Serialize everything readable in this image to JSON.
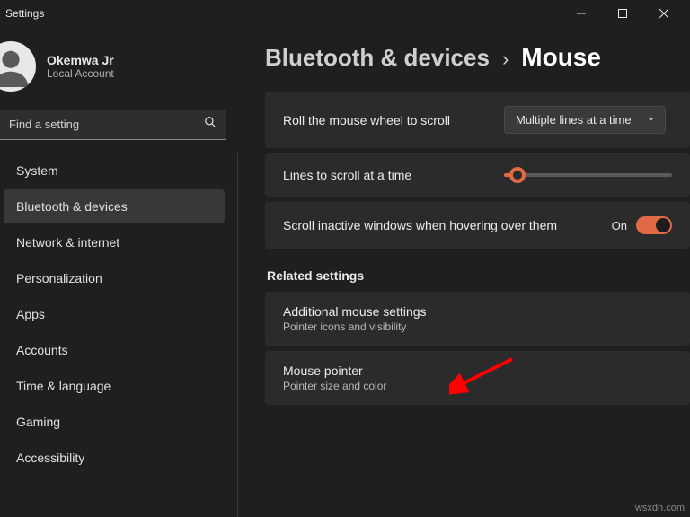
{
  "titlebar": {
    "title": "Settings"
  },
  "profile": {
    "name": "Okemwa Jr",
    "sub": "Local Account"
  },
  "search": {
    "placeholder": "Find a setting"
  },
  "nav": {
    "items": [
      {
        "label": "System"
      },
      {
        "label": "Bluetooth & devices"
      },
      {
        "label": "Network & internet"
      },
      {
        "label": "Personalization"
      },
      {
        "label": "Apps"
      },
      {
        "label": "Accounts"
      },
      {
        "label": "Time & language"
      },
      {
        "label": "Gaming"
      },
      {
        "label": "Accessibility"
      }
    ],
    "active_index": 1
  },
  "breadcrumb": {
    "parent": "Bluetooth & devices",
    "current": "Mouse"
  },
  "settings": {
    "roll_wheel": {
      "label": "Roll the mouse wheel to scroll",
      "value": "Multiple lines at a time"
    },
    "lines": {
      "label": "Lines to scroll at a time"
    },
    "inactive": {
      "label": "Scroll inactive windows when hovering over them",
      "state": "On"
    }
  },
  "related": {
    "title": "Related settings",
    "items": [
      {
        "title": "Additional mouse settings",
        "desc": "Pointer icons and visibility"
      },
      {
        "title": "Mouse pointer",
        "desc": "Pointer size and color"
      }
    ]
  },
  "watermark": "wsxdn.com"
}
